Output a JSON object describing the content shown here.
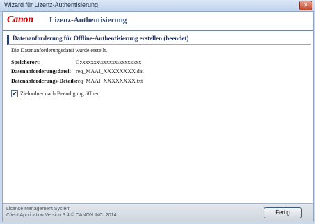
{
  "window": {
    "title": "Wizard für Lizenz-Authentisierung",
    "close_glyph": "✕"
  },
  "header": {
    "logo_text": "Canon",
    "app_title": "Lizenz-Authentisierung"
  },
  "section": {
    "heading": "Datenanforderung für Offline-Authentisierung erstellen (beendet)"
  },
  "content": {
    "status_message": "Die Datenanforderungsdatei wurde erstellt.",
    "rows": [
      {
        "label": "Speicherort:",
        "value": "C:\\xxxxxx\\xxxxxx\\xxxxxxxx"
      },
      {
        "label": "Datenanforderungsdatei:",
        "value": "req_MAAI_XXXXXXXX.dat"
      },
      {
        "label": "Datenanforderungs-Details:",
        "value": "req_MAAI_XXXXXXXX.txt"
      }
    ],
    "checkbox": {
      "checked": true,
      "check_glyph": "✔",
      "label": "Zielordner nach Beendigung öffnen"
    }
  },
  "footer": {
    "line1": "License Management System",
    "line2": "Client Application Version 3.4   © CANON INC. 2014",
    "finish_button": "Fertig"
  },
  "colors": {
    "brand_red": "#cc0000",
    "heading_blue": "#1d2f5e",
    "accent_rule": "#6b86b5"
  }
}
